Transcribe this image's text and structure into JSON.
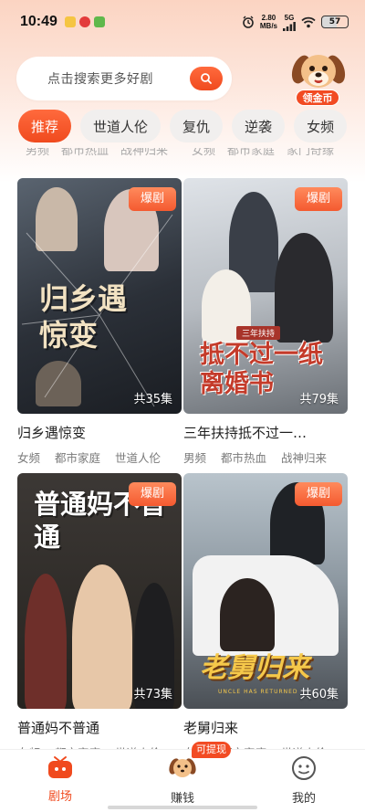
{
  "status_bar": {
    "time": "10:49",
    "net_speed_value": "2.80",
    "net_speed_unit": "MB/s",
    "signal": "5G",
    "battery": "57"
  },
  "search": {
    "placeholder": "点击搜索更多好剧"
  },
  "coin_button": {
    "label": "领金币"
  },
  "tabs": [
    {
      "label": "推荐",
      "active": true
    },
    {
      "label": "世道人伦",
      "active": false
    },
    {
      "label": "复仇",
      "active": false
    },
    {
      "label": "逆袭",
      "active": false
    },
    {
      "label": "女频",
      "active": false
    }
  ],
  "cut_row_left": "男频　都市热血　战神归来",
  "cut_row_right": "女频　都市家庭　家门奇缘",
  "dramas": [
    {
      "title": "归乡遇惊变",
      "badge": "爆剧",
      "episodes": "共35集",
      "poster_title": "归乡遇惊变",
      "tags": [
        "女频",
        "都市家庭",
        "世道人伦"
      ]
    },
    {
      "title": "三年扶持抵不过一…",
      "badge": "爆剧",
      "episodes": "共79集",
      "poster_title": "抵不过一纸离婚书",
      "poster_subtitle": "三年扶持",
      "tags": [
        "男频",
        "都市热血",
        "战神归来"
      ]
    },
    {
      "title": "普通妈不普通",
      "badge": "爆剧",
      "episodes": "共73集",
      "poster_title": "普通妈不普通",
      "tags": [
        "女频",
        "都市家庭",
        "世道人伦"
      ]
    },
    {
      "title": "老舅归来",
      "badge": "爆剧",
      "episodes": "共60集",
      "poster_title": "老舅归来",
      "poster_subtitle": "UNCLE HAS RETURNED",
      "tags": [
        "女频",
        "都市家庭",
        "世道人伦"
      ]
    }
  ],
  "bottom_nav": {
    "items": [
      {
        "label": "剧场",
        "icon": "tv-icon",
        "active": true
      },
      {
        "label": "赚钱",
        "icon": "puppy-coin-icon",
        "active": false
      },
      {
        "label": "我的",
        "icon": "profile-face-icon",
        "active": false
      }
    ],
    "withdraw_badge": "可提现"
  },
  "colors": {
    "accent": "#f04a1e",
    "badge": "#f45a30",
    "tab_inactive_bg": "#f1efee",
    "tag_text": "#7a7a7a"
  }
}
